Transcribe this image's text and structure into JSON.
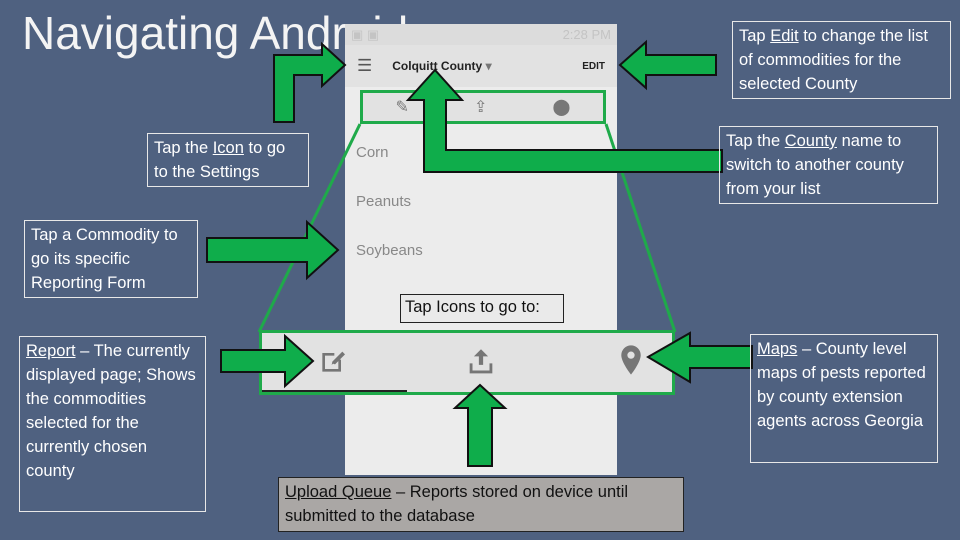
{
  "title": "Navigating Android",
  "phone": {
    "status_time": "2:28 PM",
    "county": "Colquitt County",
    "edit_label": "EDIT",
    "commodities": [
      "Corn",
      "Peanuts",
      "Soybeans"
    ],
    "icons": [
      "menu-icon",
      "report-edit-icon",
      "upload-icon",
      "map-pin-icon",
      "dropdown-icon"
    ]
  },
  "callouts": {
    "edit": {
      "pre": "Tap ",
      "link": "Edit",
      "post": " to change the list of commodities for the selected County"
    },
    "county": {
      "pre": "Tap the ",
      "link": "County",
      "post": " name to switch to another county from your list"
    },
    "settings": {
      "pre": "Tap the ",
      "link": "Icon",
      "post": " to go to the Settings"
    },
    "commodity": {
      "text": "Tap a Commodity to go its specific Reporting Form"
    },
    "tap_icons": "Tap Icons to go to:",
    "report": {
      "link": "Report",
      "post": " – The currently displayed page; Shows the commodities selected for the currently chosen county"
    },
    "maps": {
      "link": "Maps",
      "post": " – County level maps of pests reported by county extension agents across Georgia"
    },
    "upload": {
      "link": "Upload Queue",
      "post": " – Reports stored on device until submitted to the database"
    }
  },
  "colors": {
    "background": "#4f6180",
    "arrow": "#0fad4b",
    "highlight": "#1faa4a"
  }
}
